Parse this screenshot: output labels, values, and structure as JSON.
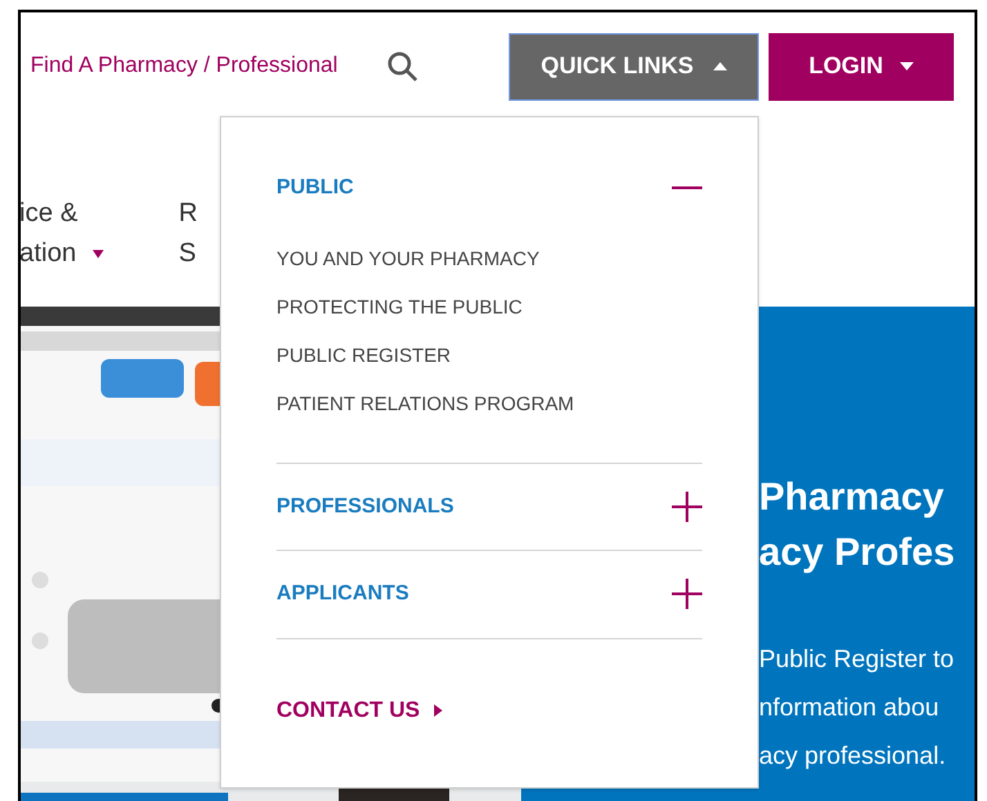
{
  "header": {
    "find_link": "Find A Pharmacy / Professional",
    "quick_links": {
      "label": "QUICK LINKS",
      "expanded": true
    },
    "login": {
      "label": "LOGIN"
    }
  },
  "nav": [
    {
      "lines": [
        "ice &",
        "ation"
      ],
      "caret": true
    },
    {
      "lines": [
        "R",
        "S"
      ],
      "caret": false
    }
  ],
  "hero": {
    "kind": "picture",
    "heading": [
      "Pharmacy",
      "acy Profes"
    ],
    "text": [
      "Public Register to",
      "nformation abou",
      "acy professional."
    ]
  },
  "dropdown": {
    "sections": [
      {
        "kind": "accordion",
        "title": "PUBLIC",
        "expanded": true,
        "items": [
          "YOU AND YOUR PHARMACY",
          "PROTECTING THE PUBLIC",
          "PUBLIC REGISTER",
          "PATIENT RELATIONS PROGRAM"
        ]
      },
      {
        "kind": "accordion",
        "title": "PROFESSIONALS",
        "expanded": false
      },
      {
        "kind": "accordion",
        "title": "APPLICANTS",
        "expanded": false
      },
      {
        "kind": "link",
        "title": "CONTACT US"
      }
    ]
  }
}
